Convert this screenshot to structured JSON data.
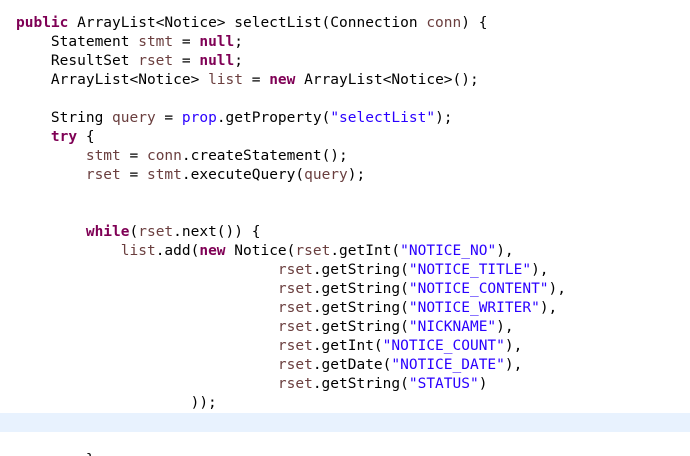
{
  "editor": {
    "language": "Java",
    "colors": {
      "keyword": "#7f0055",
      "string": "#2a00ff",
      "local_variable": "#6a3e3e",
      "default": "#000000",
      "current_line": "#e8f2fe",
      "background": "#ffffff"
    },
    "lines": [
      {
        "tokens": [
          {
            "t": "public",
            "k": "kw"
          },
          {
            "t": " ArrayList<Notice> selectList(Connection ",
            "k": "txt"
          },
          {
            "t": "conn",
            "k": "var"
          },
          {
            "t": ") {",
            "k": "txt"
          }
        ]
      },
      {
        "tokens": [
          {
            "t": "    Statement ",
            "k": "txt"
          },
          {
            "t": "stmt",
            "k": "var"
          },
          {
            "t": " = ",
            "k": "txt"
          },
          {
            "t": "null",
            "k": "kw"
          },
          {
            "t": ";",
            "k": "txt"
          }
        ]
      },
      {
        "tokens": [
          {
            "t": "    ResultSet ",
            "k": "txt"
          },
          {
            "t": "rset",
            "k": "var"
          },
          {
            "t": " = ",
            "k": "txt"
          },
          {
            "t": "null",
            "k": "kw"
          },
          {
            "t": ";",
            "k": "txt"
          }
        ]
      },
      {
        "tokens": [
          {
            "t": "    ArrayList<Notice> ",
            "k": "txt"
          },
          {
            "t": "list",
            "k": "var"
          },
          {
            "t": " = ",
            "k": "txt"
          },
          {
            "t": "new",
            "k": "kw"
          },
          {
            "t": " ArrayList<Notice>();",
            "k": "txt"
          }
        ]
      },
      {
        "tokens": []
      },
      {
        "tokens": [
          {
            "t": "    String ",
            "k": "txt"
          },
          {
            "t": "query",
            "k": "var"
          },
          {
            "t": " = ",
            "k": "txt"
          },
          {
            "t": "prop",
            "k": "str"
          },
          {
            "t": ".getProperty(",
            "k": "txt"
          },
          {
            "t": "\"selectList\"",
            "k": "str"
          },
          {
            "t": ");",
            "k": "txt"
          }
        ]
      },
      {
        "tokens": [
          {
            "t": "    ",
            "k": "txt"
          },
          {
            "t": "try",
            "k": "kw"
          },
          {
            "t": " {",
            "k": "txt"
          }
        ]
      },
      {
        "tokens": [
          {
            "t": "        ",
            "k": "txt"
          },
          {
            "t": "stmt",
            "k": "var"
          },
          {
            "t": " = ",
            "k": "txt"
          },
          {
            "t": "conn",
            "k": "var"
          },
          {
            "t": ".createStatement();",
            "k": "txt"
          }
        ]
      },
      {
        "tokens": [
          {
            "t": "        ",
            "k": "txt"
          },
          {
            "t": "rset",
            "k": "var"
          },
          {
            "t": " = ",
            "k": "txt"
          },
          {
            "t": "stmt",
            "k": "var"
          },
          {
            "t": ".executeQuery(",
            "k": "txt"
          },
          {
            "t": "query",
            "k": "var"
          },
          {
            "t": ");",
            "k": "txt"
          }
        ]
      },
      {
        "tokens": []
      },
      {
        "tokens": []
      },
      {
        "tokens": [
          {
            "t": "        ",
            "k": "txt"
          },
          {
            "t": "while",
            "k": "kw"
          },
          {
            "t": "(",
            "k": "txt"
          },
          {
            "t": "rset",
            "k": "var"
          },
          {
            "t": ".next()) {",
            "k": "txt"
          }
        ]
      },
      {
        "tokens": [
          {
            "t": "            ",
            "k": "txt"
          },
          {
            "t": "list",
            "k": "var"
          },
          {
            "t": ".add(",
            "k": "txt"
          },
          {
            "t": "new",
            "k": "kw"
          },
          {
            "t": " Notice(",
            "k": "txt"
          },
          {
            "t": "rset",
            "k": "var"
          },
          {
            "t": ".getInt(",
            "k": "txt"
          },
          {
            "t": "\"NOTICE_NO\"",
            "k": "str"
          },
          {
            "t": "),",
            "k": "txt"
          }
        ]
      },
      {
        "tokens": [
          {
            "t": "                              ",
            "k": "txt"
          },
          {
            "t": "rset",
            "k": "var"
          },
          {
            "t": ".getString(",
            "k": "txt"
          },
          {
            "t": "\"NOTICE_TITLE\"",
            "k": "str"
          },
          {
            "t": "),",
            "k": "txt"
          }
        ]
      },
      {
        "tokens": [
          {
            "t": "                              ",
            "k": "txt"
          },
          {
            "t": "rset",
            "k": "var"
          },
          {
            "t": ".getString(",
            "k": "txt"
          },
          {
            "t": "\"NOTICE_CONTENT\"",
            "k": "str"
          },
          {
            "t": "),",
            "k": "txt"
          }
        ]
      },
      {
        "tokens": [
          {
            "t": "                              ",
            "k": "txt"
          },
          {
            "t": "rset",
            "k": "var"
          },
          {
            "t": ".getString(",
            "k": "txt"
          },
          {
            "t": "\"NOTICE_WRITER\"",
            "k": "str"
          },
          {
            "t": "),",
            "k": "txt"
          }
        ]
      },
      {
        "tokens": [
          {
            "t": "                              ",
            "k": "txt"
          },
          {
            "t": "rset",
            "k": "var"
          },
          {
            "t": ".getString(",
            "k": "txt"
          },
          {
            "t": "\"NICKNAME\"",
            "k": "str"
          },
          {
            "t": "),",
            "k": "txt"
          }
        ]
      },
      {
        "tokens": [
          {
            "t": "                              ",
            "k": "txt"
          },
          {
            "t": "rset",
            "k": "var"
          },
          {
            "t": ".getInt(",
            "k": "txt"
          },
          {
            "t": "\"NOTICE_COUNT\"",
            "k": "str"
          },
          {
            "t": "),",
            "k": "txt"
          }
        ]
      },
      {
        "tokens": [
          {
            "t": "                              ",
            "k": "txt"
          },
          {
            "t": "rset",
            "k": "var"
          },
          {
            "t": ".getDate(",
            "k": "txt"
          },
          {
            "t": "\"NOTICE_DATE\"",
            "k": "str"
          },
          {
            "t": "),",
            "k": "txt"
          }
        ]
      },
      {
        "tokens": [
          {
            "t": "                              ",
            "k": "txt"
          },
          {
            "t": "rset",
            "k": "var"
          },
          {
            "t": ".getString(",
            "k": "txt"
          },
          {
            "t": "\"STATUS\"",
            "k": "str"
          },
          {
            "t": ")",
            "k": "txt"
          }
        ]
      },
      {
        "tokens": [
          {
            "t": "                    ));",
            "k": "txt"
          }
        ]
      },
      {
        "tokens": [],
        "current": true
      },
      {
        "tokens": []
      },
      {
        "tokens": [
          {
            "t": "        }",
            "k": "txt"
          }
        ]
      }
    ]
  }
}
